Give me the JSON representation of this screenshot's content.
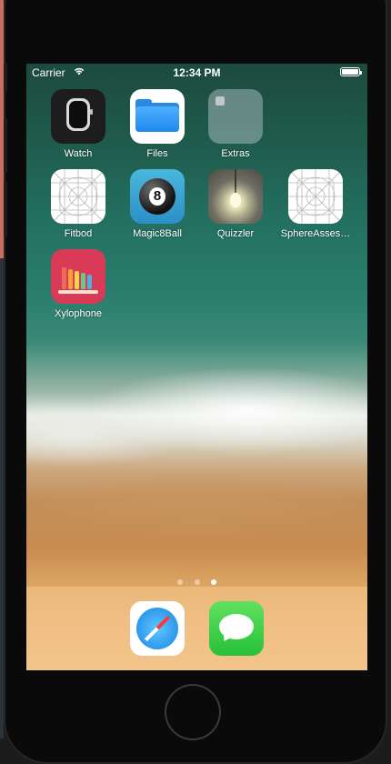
{
  "status_bar": {
    "carrier": "Carrier",
    "time": "12:34 PM"
  },
  "apps": [
    {
      "label": "Watch",
      "icon": "watch-icon"
    },
    {
      "label": "Files",
      "icon": "files-folder-icon"
    },
    {
      "label": "Extras",
      "icon": "folder-group-icon"
    },
    {
      "label": "Fitbod",
      "icon": "blank-app-template-icon"
    },
    {
      "label": "Magic8Ball",
      "icon": "magic-8-ball-icon"
    },
    {
      "label": "Quizzler",
      "icon": "light-bulb-icon"
    },
    {
      "label": "SphereAsses…",
      "icon": "blank-app-template-icon"
    },
    {
      "label": "Xylophone",
      "icon": "xylophone-icon"
    }
  ],
  "magic8_glyph": "8",
  "page_dots": {
    "count": 3,
    "active_index": 2
  },
  "dock": [
    {
      "name": "Safari",
      "icon": "safari-compass-icon"
    },
    {
      "name": "Messages",
      "icon": "messages-bubble-icon"
    }
  ],
  "colors": {
    "xylophone_bg": "#d83a57",
    "messages_green": "#27c138",
    "safari_blue": "#1a84e5",
    "files_blue": "#2a8ae3"
  }
}
